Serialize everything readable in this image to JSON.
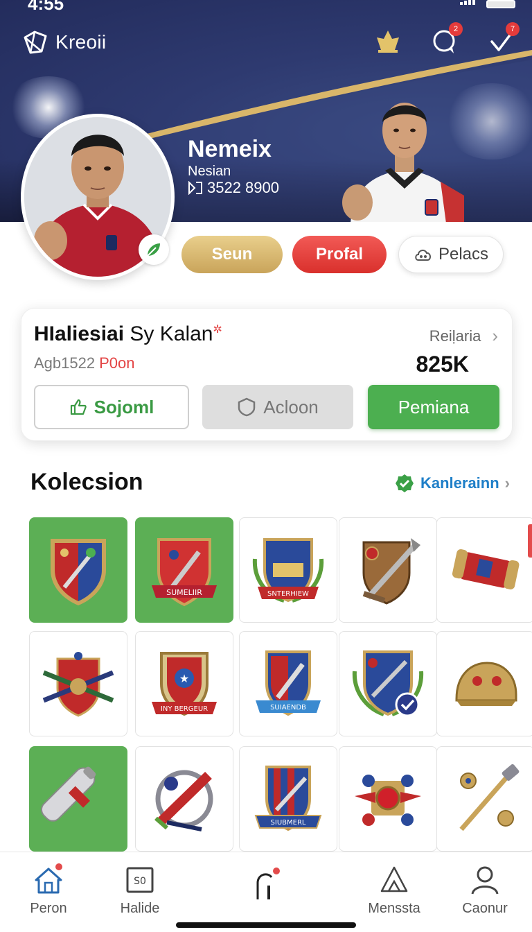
{
  "status_bar": {
    "time": "4:55"
  },
  "brand": {
    "name": "Kreoii"
  },
  "header": {
    "notif_count_1": "2",
    "notif_count_2": "7"
  },
  "user": {
    "name": "Nemeix",
    "country": "Nesian",
    "id": "3522 8900"
  },
  "pills": {
    "gold": "Seun",
    "red": "Profal",
    "white": "Pelacs"
  },
  "card": {
    "title_bold": "HIaliesiai",
    "title_rest": "Sy Kalan",
    "sub_grey": "Agb1522",
    "sub_red": "P0on",
    "right_label": "Reiḷaria",
    "value": "825K",
    "btn_outline": "Sojoml",
    "btn_grey": "Acloon",
    "btn_green": "Pemiana"
  },
  "collection": {
    "title": "Kolecsion",
    "link": "Kanlerainn",
    "banners": [
      "SUMELIIR",
      "SNTERHIEW",
      "INY BERGEUR",
      "SUIAENDB",
      "SIUBMERL"
    ]
  },
  "nav": {
    "items": [
      {
        "label": "Peron"
      },
      {
        "label": "Halide"
      },
      {
        "label": ""
      },
      {
        "label": "Menssta"
      },
      {
        "label": "Caonur"
      }
    ]
  },
  "colors": {
    "header_bg": "#2e3a70",
    "gold": "#c9a45a",
    "red": "#e03a36",
    "green": "#4caf50",
    "link_blue": "#1f7fc8"
  }
}
